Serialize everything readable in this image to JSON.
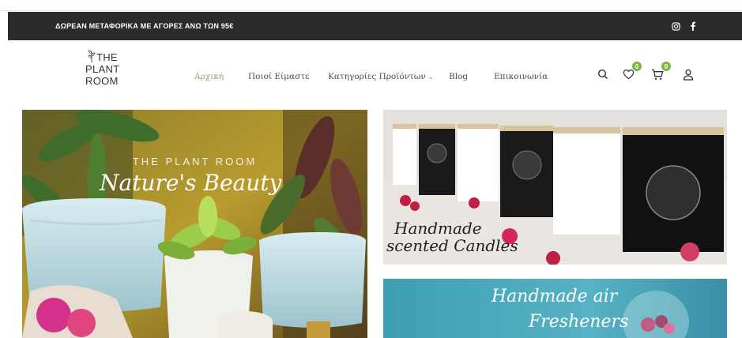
{
  "announcement": {
    "text": "ΔΩΡΕΑΝ ΜΕΤΑΦΟΡΙΚΑ ΜΕ ΑΓΟΡΕΣ ΑΝΩ ΤΩΝ 95€"
  },
  "social": {
    "icons": [
      "instagram-icon",
      "facebook-icon"
    ]
  },
  "logo": {
    "line1": "THE",
    "line2": "PLANT",
    "line3": "ROOM"
  },
  "nav": {
    "items": [
      {
        "label": "Αρχική",
        "active": true
      },
      {
        "label": "Ποιοί Είμαστε",
        "active": false
      },
      {
        "label": "Κατηγορίες Προϊόντων",
        "active": false,
        "has_dropdown": true
      },
      {
        "label": "Blog",
        "active": false
      },
      {
        "label": "Επικοινωνία",
        "active": false
      }
    ]
  },
  "header_icons": {
    "search": "search-icon",
    "wishlist": {
      "icon": "heart-icon",
      "count": "0"
    },
    "cart": {
      "icon": "cart-icon",
      "count": "0"
    },
    "account": "user-icon"
  },
  "banners": {
    "main": {
      "subtitle": "THE PLANT ROOM",
      "title": "Nature's Beauty"
    },
    "candles": {
      "line1": "Handmade",
      "line2": "scented Candles"
    },
    "fresheners": {
      "line1": "Handmade air",
      "line2": "Fresheners"
    }
  },
  "colors": {
    "announcement_bg": "#2b2b2b",
    "accent_green": "#8aa66a",
    "badge_green": "#7fb542"
  }
}
